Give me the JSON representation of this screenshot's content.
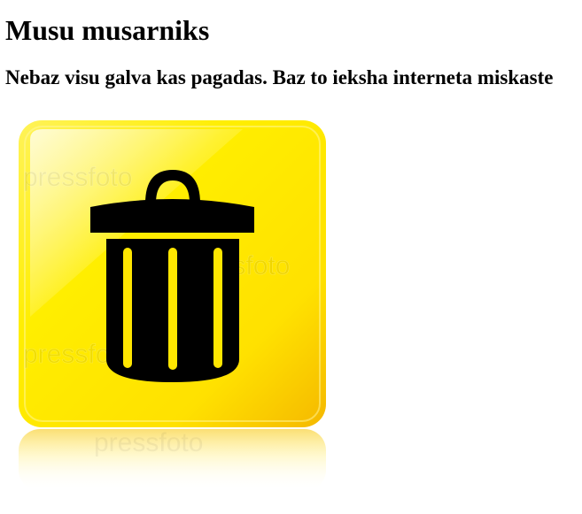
{
  "page": {
    "title": "Musu musarniks",
    "subtitle": "Nebaz visu galva kas pagadas. Baz to ieksha interneta miskaste"
  },
  "image": {
    "icon": "trash-can-icon",
    "watermark_text": "pressfoto",
    "colors": {
      "button_yellow": "#ffe600",
      "button_orange": "#f5b800",
      "icon_black": "#000000"
    }
  }
}
